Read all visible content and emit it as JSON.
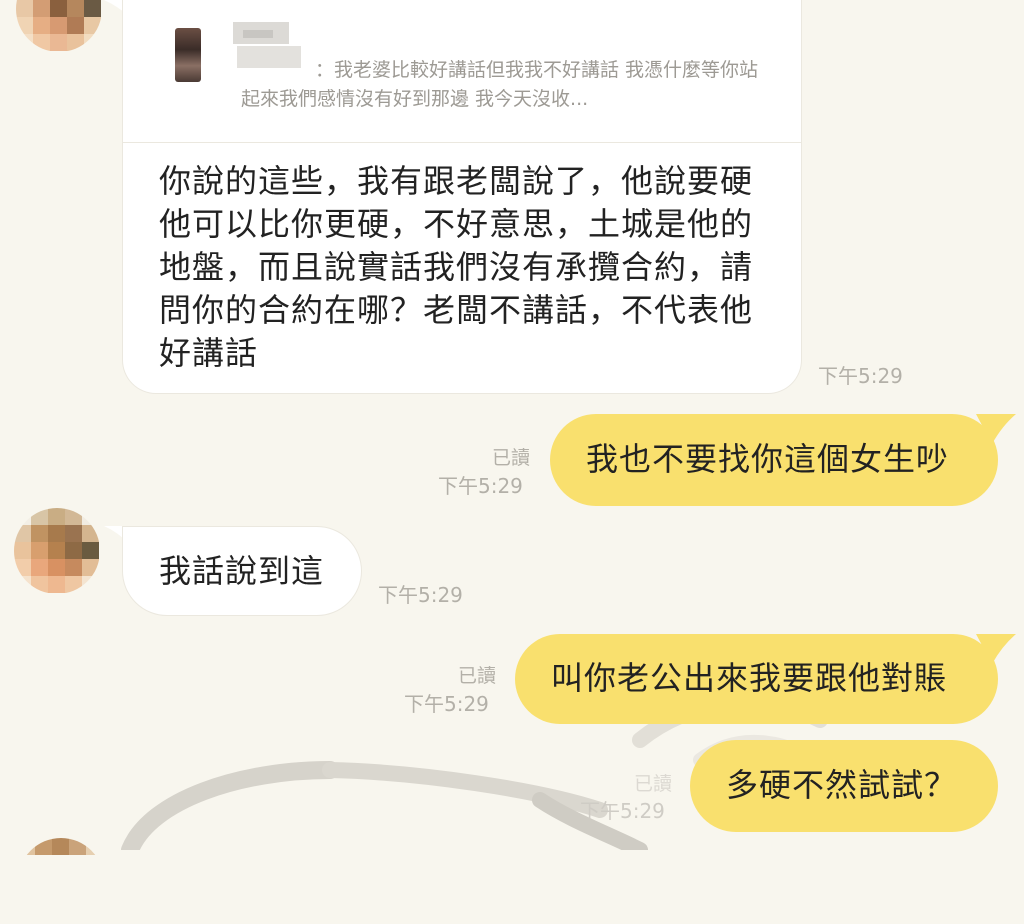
{
  "chat": {
    "reply_preview": {
      "quoted_text": "：我老婆比較好講話但我我不好講話 我憑什麼等你站起來我們感情沒有好到那邊 我今天沒收..."
    },
    "messages": [
      {
        "side": "received",
        "text": "你說的這些，我有跟老闆說了，他說要硬他可以比你更硬，不好意思，土城是他的地盤，而且說實話我們沒有承攬合約，請問你的合約在哪？老闆不講話，不代表他好講話",
        "time": "下午5:29"
      },
      {
        "side": "sent",
        "text": "我也不要找你這個女生吵",
        "read": "已讀",
        "time": "下午5:29"
      },
      {
        "side": "received",
        "text": "我話說到這",
        "time": "下午5:29"
      },
      {
        "side": "sent",
        "text": "叫你老公出來我要跟他對賬",
        "read": "已讀",
        "time": "下午5:29"
      },
      {
        "side": "sent",
        "text": "多硬不然試試？",
        "read": "已讀",
        "time": "下午5:29"
      }
    ]
  },
  "colors": {
    "background": "#f8f6ee",
    "sent_bubble": "#f9e06e",
    "received_bubble": "#ffffff",
    "meta_text": "#b3b0a8"
  },
  "icons": {
    "avatar": "pixelated-avatar-icon"
  }
}
